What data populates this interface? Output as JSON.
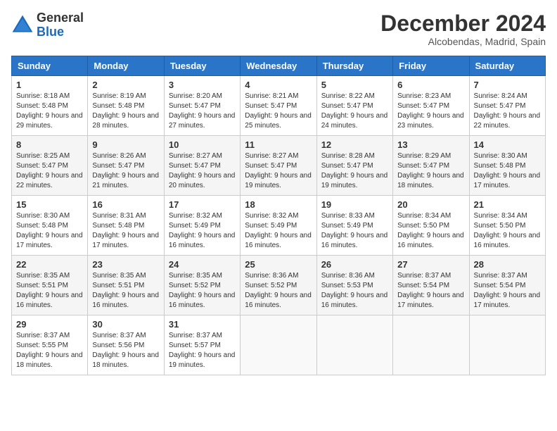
{
  "logo": {
    "general": "General",
    "blue": "Blue"
  },
  "header": {
    "month": "December 2024",
    "location": "Alcobendas, Madrid, Spain"
  },
  "days_of_week": [
    "Sunday",
    "Monday",
    "Tuesday",
    "Wednesday",
    "Thursday",
    "Friday",
    "Saturday"
  ],
  "weeks": [
    [
      {
        "day": "1",
        "sunrise": "Sunrise: 8:18 AM",
        "sunset": "Sunset: 5:48 PM",
        "daylight": "Daylight: 9 hours and 29 minutes."
      },
      {
        "day": "2",
        "sunrise": "Sunrise: 8:19 AM",
        "sunset": "Sunset: 5:48 PM",
        "daylight": "Daylight: 9 hours and 28 minutes."
      },
      {
        "day": "3",
        "sunrise": "Sunrise: 8:20 AM",
        "sunset": "Sunset: 5:47 PM",
        "daylight": "Daylight: 9 hours and 27 minutes."
      },
      {
        "day": "4",
        "sunrise": "Sunrise: 8:21 AM",
        "sunset": "Sunset: 5:47 PM",
        "daylight": "Daylight: 9 hours and 25 minutes."
      },
      {
        "day": "5",
        "sunrise": "Sunrise: 8:22 AM",
        "sunset": "Sunset: 5:47 PM",
        "daylight": "Daylight: 9 hours and 24 minutes."
      },
      {
        "day": "6",
        "sunrise": "Sunrise: 8:23 AM",
        "sunset": "Sunset: 5:47 PM",
        "daylight": "Daylight: 9 hours and 23 minutes."
      },
      {
        "day": "7",
        "sunrise": "Sunrise: 8:24 AM",
        "sunset": "Sunset: 5:47 PM",
        "daylight": "Daylight: 9 hours and 22 minutes."
      }
    ],
    [
      {
        "day": "8",
        "sunrise": "Sunrise: 8:25 AM",
        "sunset": "Sunset: 5:47 PM",
        "daylight": "Daylight: 9 hours and 22 minutes."
      },
      {
        "day": "9",
        "sunrise": "Sunrise: 8:26 AM",
        "sunset": "Sunset: 5:47 PM",
        "daylight": "Daylight: 9 hours and 21 minutes."
      },
      {
        "day": "10",
        "sunrise": "Sunrise: 8:27 AM",
        "sunset": "Sunset: 5:47 PM",
        "daylight": "Daylight: 9 hours and 20 minutes."
      },
      {
        "day": "11",
        "sunrise": "Sunrise: 8:27 AM",
        "sunset": "Sunset: 5:47 PM",
        "daylight": "Daylight: 9 hours and 19 minutes."
      },
      {
        "day": "12",
        "sunrise": "Sunrise: 8:28 AM",
        "sunset": "Sunset: 5:47 PM",
        "daylight": "Daylight: 9 hours and 19 minutes."
      },
      {
        "day": "13",
        "sunrise": "Sunrise: 8:29 AM",
        "sunset": "Sunset: 5:47 PM",
        "daylight": "Daylight: 9 hours and 18 minutes."
      },
      {
        "day": "14",
        "sunrise": "Sunrise: 8:30 AM",
        "sunset": "Sunset: 5:48 PM",
        "daylight": "Daylight: 9 hours and 17 minutes."
      }
    ],
    [
      {
        "day": "15",
        "sunrise": "Sunrise: 8:30 AM",
        "sunset": "Sunset: 5:48 PM",
        "daylight": "Daylight: 9 hours and 17 minutes."
      },
      {
        "day": "16",
        "sunrise": "Sunrise: 8:31 AM",
        "sunset": "Sunset: 5:48 PM",
        "daylight": "Daylight: 9 hours and 17 minutes."
      },
      {
        "day": "17",
        "sunrise": "Sunrise: 8:32 AM",
        "sunset": "Sunset: 5:49 PM",
        "daylight": "Daylight: 9 hours and 16 minutes."
      },
      {
        "day": "18",
        "sunrise": "Sunrise: 8:32 AM",
        "sunset": "Sunset: 5:49 PM",
        "daylight": "Daylight: 9 hours and 16 minutes."
      },
      {
        "day": "19",
        "sunrise": "Sunrise: 8:33 AM",
        "sunset": "Sunset: 5:49 PM",
        "daylight": "Daylight: 9 hours and 16 minutes."
      },
      {
        "day": "20",
        "sunrise": "Sunrise: 8:34 AM",
        "sunset": "Sunset: 5:50 PM",
        "daylight": "Daylight: 9 hours and 16 minutes."
      },
      {
        "day": "21",
        "sunrise": "Sunrise: 8:34 AM",
        "sunset": "Sunset: 5:50 PM",
        "daylight": "Daylight: 9 hours and 16 minutes."
      }
    ],
    [
      {
        "day": "22",
        "sunrise": "Sunrise: 8:35 AM",
        "sunset": "Sunset: 5:51 PM",
        "daylight": "Daylight: 9 hours and 16 minutes."
      },
      {
        "day": "23",
        "sunrise": "Sunrise: 8:35 AM",
        "sunset": "Sunset: 5:51 PM",
        "daylight": "Daylight: 9 hours and 16 minutes."
      },
      {
        "day": "24",
        "sunrise": "Sunrise: 8:35 AM",
        "sunset": "Sunset: 5:52 PM",
        "daylight": "Daylight: 9 hours and 16 minutes."
      },
      {
        "day": "25",
        "sunrise": "Sunrise: 8:36 AM",
        "sunset": "Sunset: 5:52 PM",
        "daylight": "Daylight: 9 hours and 16 minutes."
      },
      {
        "day": "26",
        "sunrise": "Sunrise: 8:36 AM",
        "sunset": "Sunset: 5:53 PM",
        "daylight": "Daylight: 9 hours and 16 minutes."
      },
      {
        "day": "27",
        "sunrise": "Sunrise: 8:37 AM",
        "sunset": "Sunset: 5:54 PM",
        "daylight": "Daylight: 9 hours and 17 minutes."
      },
      {
        "day": "28",
        "sunrise": "Sunrise: 8:37 AM",
        "sunset": "Sunset: 5:54 PM",
        "daylight": "Daylight: 9 hours and 17 minutes."
      }
    ],
    [
      {
        "day": "29",
        "sunrise": "Sunrise: 8:37 AM",
        "sunset": "Sunset: 5:55 PM",
        "daylight": "Daylight: 9 hours and 18 minutes."
      },
      {
        "day": "30",
        "sunrise": "Sunrise: 8:37 AM",
        "sunset": "Sunset: 5:56 PM",
        "daylight": "Daylight: 9 hours and 18 minutes."
      },
      {
        "day": "31",
        "sunrise": "Sunrise: 8:37 AM",
        "sunset": "Sunset: 5:57 PM",
        "daylight": "Daylight: 9 hours and 19 minutes."
      },
      null,
      null,
      null,
      null
    ]
  ]
}
